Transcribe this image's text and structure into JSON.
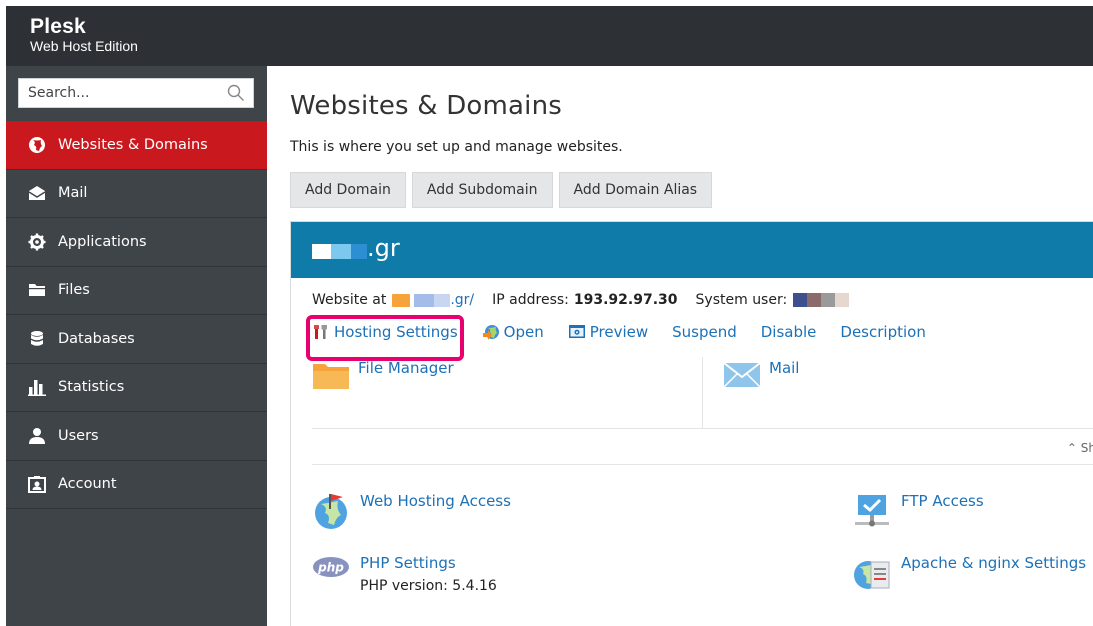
{
  "brand": {
    "name": "Plesk",
    "edition": "Web Host Edition"
  },
  "search": {
    "placeholder": "Search..."
  },
  "sidebar": {
    "items": [
      {
        "label": "Websites & Domains",
        "icon": "globe-icon",
        "active": true
      },
      {
        "label": "Mail",
        "icon": "envelope-icon"
      },
      {
        "label": "Applications",
        "icon": "gear-icon"
      },
      {
        "label": "Files",
        "icon": "folder-icon"
      },
      {
        "label": "Databases",
        "icon": "database-icon"
      },
      {
        "label": "Statistics",
        "icon": "bar-chart-icon"
      },
      {
        "label": "Users",
        "icon": "user-icon"
      },
      {
        "label": "Account",
        "icon": "account-icon"
      }
    ]
  },
  "main": {
    "title": "Websites & Domains",
    "description": "This is where you set up and manage websites.",
    "buttons": [
      "Add Domain",
      "Add Subdomain",
      "Add Domain Alias"
    ]
  },
  "domain": {
    "name_visible": ".gr",
    "website_at_label": "Website at",
    "website_url_visible": ".gr/",
    "ip_label": "IP address:",
    "ip_value": "193.92.97.30",
    "system_user_label": "System user:",
    "actions": [
      "Hosting Settings",
      "Open",
      "Preview",
      "Suspend",
      "Disable",
      "Description"
    ],
    "tools": [
      "File Manager",
      "Mail"
    ],
    "show_more": "⌃ Sh",
    "features": {
      "web_hosting_access": "Web Hosting Access",
      "ftp_access": "FTP Access",
      "php_settings": "PHP Settings",
      "php_version": "PHP version: 5.4.16",
      "apache_nginx": "Apache & nginx Settings"
    }
  },
  "colors": {
    "topbar": "#2d3035",
    "sidebar": "#3f4449",
    "active": "#c9191e",
    "domain_header": "#0f7ba9",
    "link": "#1d71b7",
    "highlight": "#e8006f"
  }
}
